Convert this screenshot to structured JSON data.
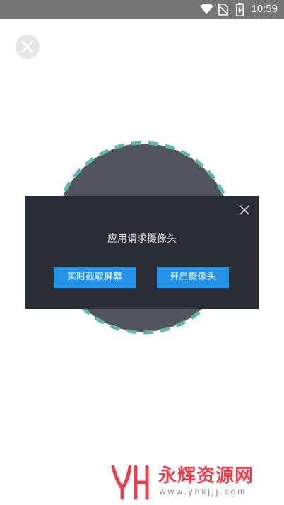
{
  "status_bar": {
    "time": "10:59",
    "icons": [
      "wifi-icon",
      "no-sim-icon",
      "battery-charging-icon"
    ]
  },
  "top_close": {
    "icon": "close-icon"
  },
  "preview": {
    "ring_color": "#5fb7ae",
    "fill_color": "#52555b"
  },
  "dialog": {
    "message": "应用请求摄像头",
    "close_icon": "close-icon",
    "buttons": {
      "screen_capture": "实时截取屏幕",
      "open_camera": "开启摄像头"
    },
    "background": "#2a2d35",
    "button_color": "#2393e8"
  },
  "watermark": {
    "title": "永辉资源网",
    "url": "www.yhkjjj.com",
    "color": "#e8404f"
  }
}
